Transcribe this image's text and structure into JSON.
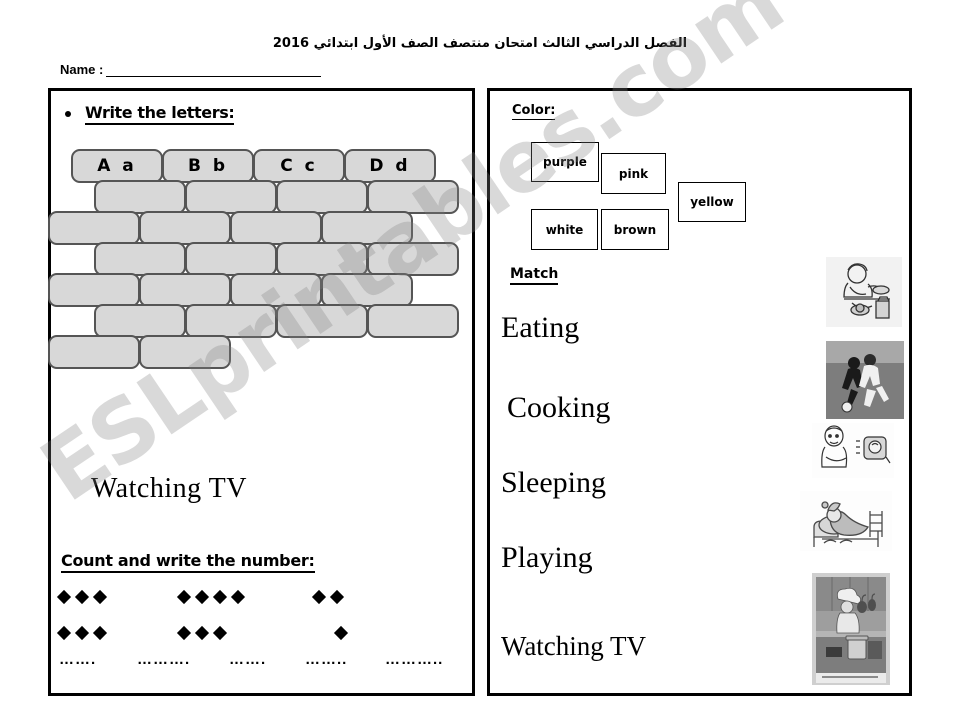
{
  "header": {
    "arabic_title": "الفصل الدراسي الثالث امتحان منتصف الصف الأول ابتدائي 2016",
    "name_label": "Name :"
  },
  "watermark": {
    "text": "ESLprintables.com"
  },
  "left_panel": {
    "write_letters_heading": "Write the letters:",
    "letters": [
      {
        "label": "A a"
      },
      {
        "label": "B b"
      },
      {
        "label": "C c"
      },
      {
        "label": "D d"
      }
    ],
    "brick_rows": [
      {
        "offset": "half",
        "bricks": [
          "",
          "",
          "",
          ""
        ]
      },
      {
        "offset": "none",
        "bricks": [
          "",
          "",
          "",
          ""
        ]
      },
      {
        "offset": "half",
        "bricks": [
          "",
          "",
          "",
          ""
        ]
      },
      {
        "offset": "none",
        "bricks": [
          "",
          "",
          "",
          ""
        ]
      },
      {
        "offset": "half",
        "bricks": [
          "",
          "",
          "",
          ""
        ]
      },
      {
        "offset": "none",
        "bricks": [
          "",
          ""
        ]
      }
    ],
    "watching_tv_label": "Watching TV",
    "count_heading": "Count and write the number:",
    "count_groups": [
      {
        "row1": 3,
        "row2": 3
      },
      {
        "row1": 4,
        "row2": 3
      },
      {
        "row1": 2,
        "row2": 1
      }
    ],
    "answer_lines": [
      "…….",
      "……….",
      "…….",
      "……..",
      "……….."
    ]
  },
  "right_panel": {
    "color_heading": "Color:",
    "color_boxes": [
      {
        "label": "purple"
      },
      {
        "label": "pink"
      },
      {
        "label": "yellow"
      },
      {
        "label": "white"
      },
      {
        "label": "brown"
      }
    ],
    "match_heading": "Match",
    "match_words": [
      {
        "label": "Eating"
      },
      {
        "label": "Cooking"
      },
      {
        "label": "Sleeping"
      },
      {
        "label": "Playing"
      },
      {
        "label": "Watching TV"
      }
    ],
    "match_images": [
      {
        "name": "boy-eating-image"
      },
      {
        "name": "soccer-players-image"
      },
      {
        "name": "man-watching-tv-image"
      },
      {
        "name": "person-sleeping-image"
      },
      {
        "name": "chef-cooking-image"
      }
    ]
  }
}
